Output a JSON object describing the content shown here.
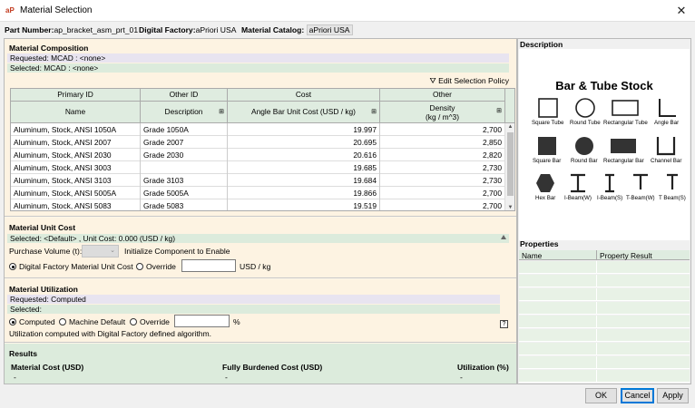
{
  "window": {
    "title": "Material Selection",
    "app_icon_text": "aP",
    "close_glyph": "✕"
  },
  "info": {
    "part_label": "Part Number:",
    "part_value": "ap_bracket_asm_prt_01",
    "factory_label": "Digital Factory:",
    "factory_value": "aPriori USA",
    "catalog_label": "Material Catalog:",
    "catalog_value": "aPriori USA"
  },
  "composition": {
    "title": "Material Composition",
    "requested": "Requested:  MCAD  : <none>",
    "selected": "Selected:  MCAD  : <none>",
    "edit_policy": "Edit Selection Policy",
    "group_headers": [
      "Primary ID",
      "Other ID",
      "Cost",
      "Other"
    ],
    "column_headers": [
      "Name",
      "Description",
      "Angle Bar Unit Cost (USD / kg)",
      "Density",
      "(kg / m^3)"
    ],
    "rows": [
      {
        "name": "Aluminum, Stock, ANSI 1050A",
        "desc": "Grade 1050A",
        "cost": "19.997",
        "density": "2,700"
      },
      {
        "name": "Aluminum, Stock, ANSI 2007",
        "desc": "Grade 2007",
        "cost": "20.695",
        "density": "2,850"
      },
      {
        "name": "Aluminum, Stock, ANSI 2030",
        "desc": "Grade 2030",
        "cost": "20.616",
        "density": "2,820"
      },
      {
        "name": "Aluminum, Stock, ANSI 3003",
        "desc": "",
        "cost": "19.685",
        "density": "2,730"
      },
      {
        "name": "Aluminum, Stock, ANSI 3103",
        "desc": "Grade 3103",
        "cost": "19.684",
        "density": "2,730"
      },
      {
        "name": "Aluminum, Stock, ANSI 5005A",
        "desc": "Grade 5005A",
        "cost": "19.866",
        "density": "2,700"
      },
      {
        "name": "Aluminum, Stock, ANSI 5083",
        "desc": "Grade 5083",
        "cost": "19.519",
        "density": "2,700"
      }
    ]
  },
  "unit_cost": {
    "title": "Material Unit Cost",
    "selected": "Selected: <Default> , Unit Cost: 0.000 (USD / kg)",
    "purchase_label": "Purchase Volume (t):",
    "init_text": "Initialize Component to Enable",
    "opt_factory": "Digital Factory Material Unit Cost",
    "opt_override": "Override",
    "unit": "USD / kg"
  },
  "utilization": {
    "title": "Material Utilization",
    "requested": "Requested:  Computed",
    "selected": "Selected:",
    "opt_computed": "Computed",
    "opt_machine": "Machine Default",
    "opt_override": "Override",
    "unit": "%",
    "note": "Utilization computed with Digital Factory defined algorithm.",
    "help": "?"
  },
  "results": {
    "title": "Results",
    "material_cost_label": "Material Cost (USD)",
    "fully_burdened_label": "Fully Burdened Cost (USD)",
    "utilization_label": "Utilization (%)",
    "material_cost_value": "-",
    "fully_burdened_value": "-",
    "utilization_value": "-"
  },
  "description": {
    "title": "Description",
    "heading": "Bar & Tube Stock",
    "shapes": [
      "Square Tube",
      "Round Tube",
      "Rectangular Tube",
      "Angle Bar",
      "Square Bar",
      "Round Bar",
      "Rectangular Bar",
      "Channel Bar",
      "Hex Bar",
      "I-Beam(W)",
      "I-Beam(S)",
      "T-Beam(W)",
      "T Beam(S)"
    ]
  },
  "properties": {
    "title": "Properties",
    "col_name": "Name",
    "col_result": "Property Result"
  },
  "buttons": {
    "ok": "OK",
    "cancel": "Cancel",
    "apply": "Apply"
  }
}
